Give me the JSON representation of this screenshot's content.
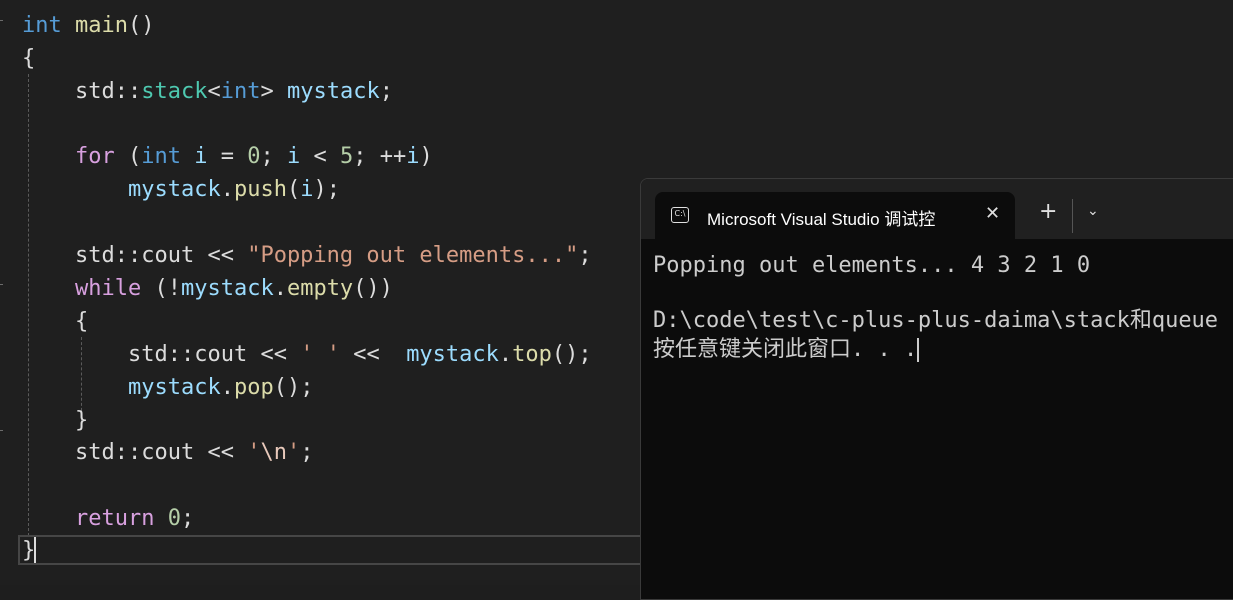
{
  "editor": {
    "lines": {
      "l1": {
        "kw_int": "int",
        "fn_main": "main",
        "paren": "()"
      },
      "l2": {
        "brace": "{"
      },
      "l3": {
        "ns": "std::",
        "type": "stack",
        "lt": "<",
        "kw_int": "int",
        "gt": ">",
        "var": "mystack",
        "semi": ";"
      },
      "l4": {
        "for": "for",
        "open": " (",
        "kw_int": "int",
        "var_i": "i",
        "eq": " = ",
        "zero": "0",
        "semi1": "; ",
        "var_i2": "i",
        "lt": " < ",
        "five": "5",
        "semi2": "; ",
        "inc": "++",
        "var_i3": "i",
        "close": ")"
      },
      "l5": {
        "var": "mystack",
        "dot": ".",
        "fn": "push",
        "open": "(",
        "var_i": "i",
        "close": ");"
      },
      "l6": {
        "ns": "std::cout ",
        "op": "<< ",
        "str": "\"Popping out elements...\"",
        "semi": ";"
      },
      "l7": {
        "while": "while",
        "open": " (!",
        "var": "mystack",
        "dot": ".",
        "fn": "empty",
        "close": "())"
      },
      "l8": {
        "brace": "{"
      },
      "l9": {
        "ns": "std::cout ",
        "op": "<< ",
        "str": "' '",
        "op2": " << ",
        "var": "mystack",
        "dot": ".",
        "fn": "top",
        "close": "();"
      },
      "l10": {
        "var": "mystack",
        "dot": ".",
        "fn": "pop",
        "close": "();"
      },
      "l11": {
        "brace": "}"
      },
      "l12": {
        "ns": "std::cout ",
        "op": "<< ",
        "q1": "'",
        "esc": "\\n",
        "q2": "'",
        "semi": ";"
      },
      "l13": {
        "ret": "return",
        "sp": " ",
        "zero": "0",
        "semi": ";"
      },
      "l14": {
        "brace": "}"
      }
    }
  },
  "terminal": {
    "tab_title": "Microsoft Visual Studio 调试控",
    "tab_icon_text": "C:\\",
    "close_glyph": "✕",
    "new_tab_glyph": "+",
    "dropdown_glyph": "⌄",
    "output_line1": "Popping out elements... 4 3 2 1 0",
    "output_line2": "D:\\code\\test\\c-plus-plus-daima\\stack和queue",
    "output_line3": "按任意键关闭此窗口. . ."
  }
}
